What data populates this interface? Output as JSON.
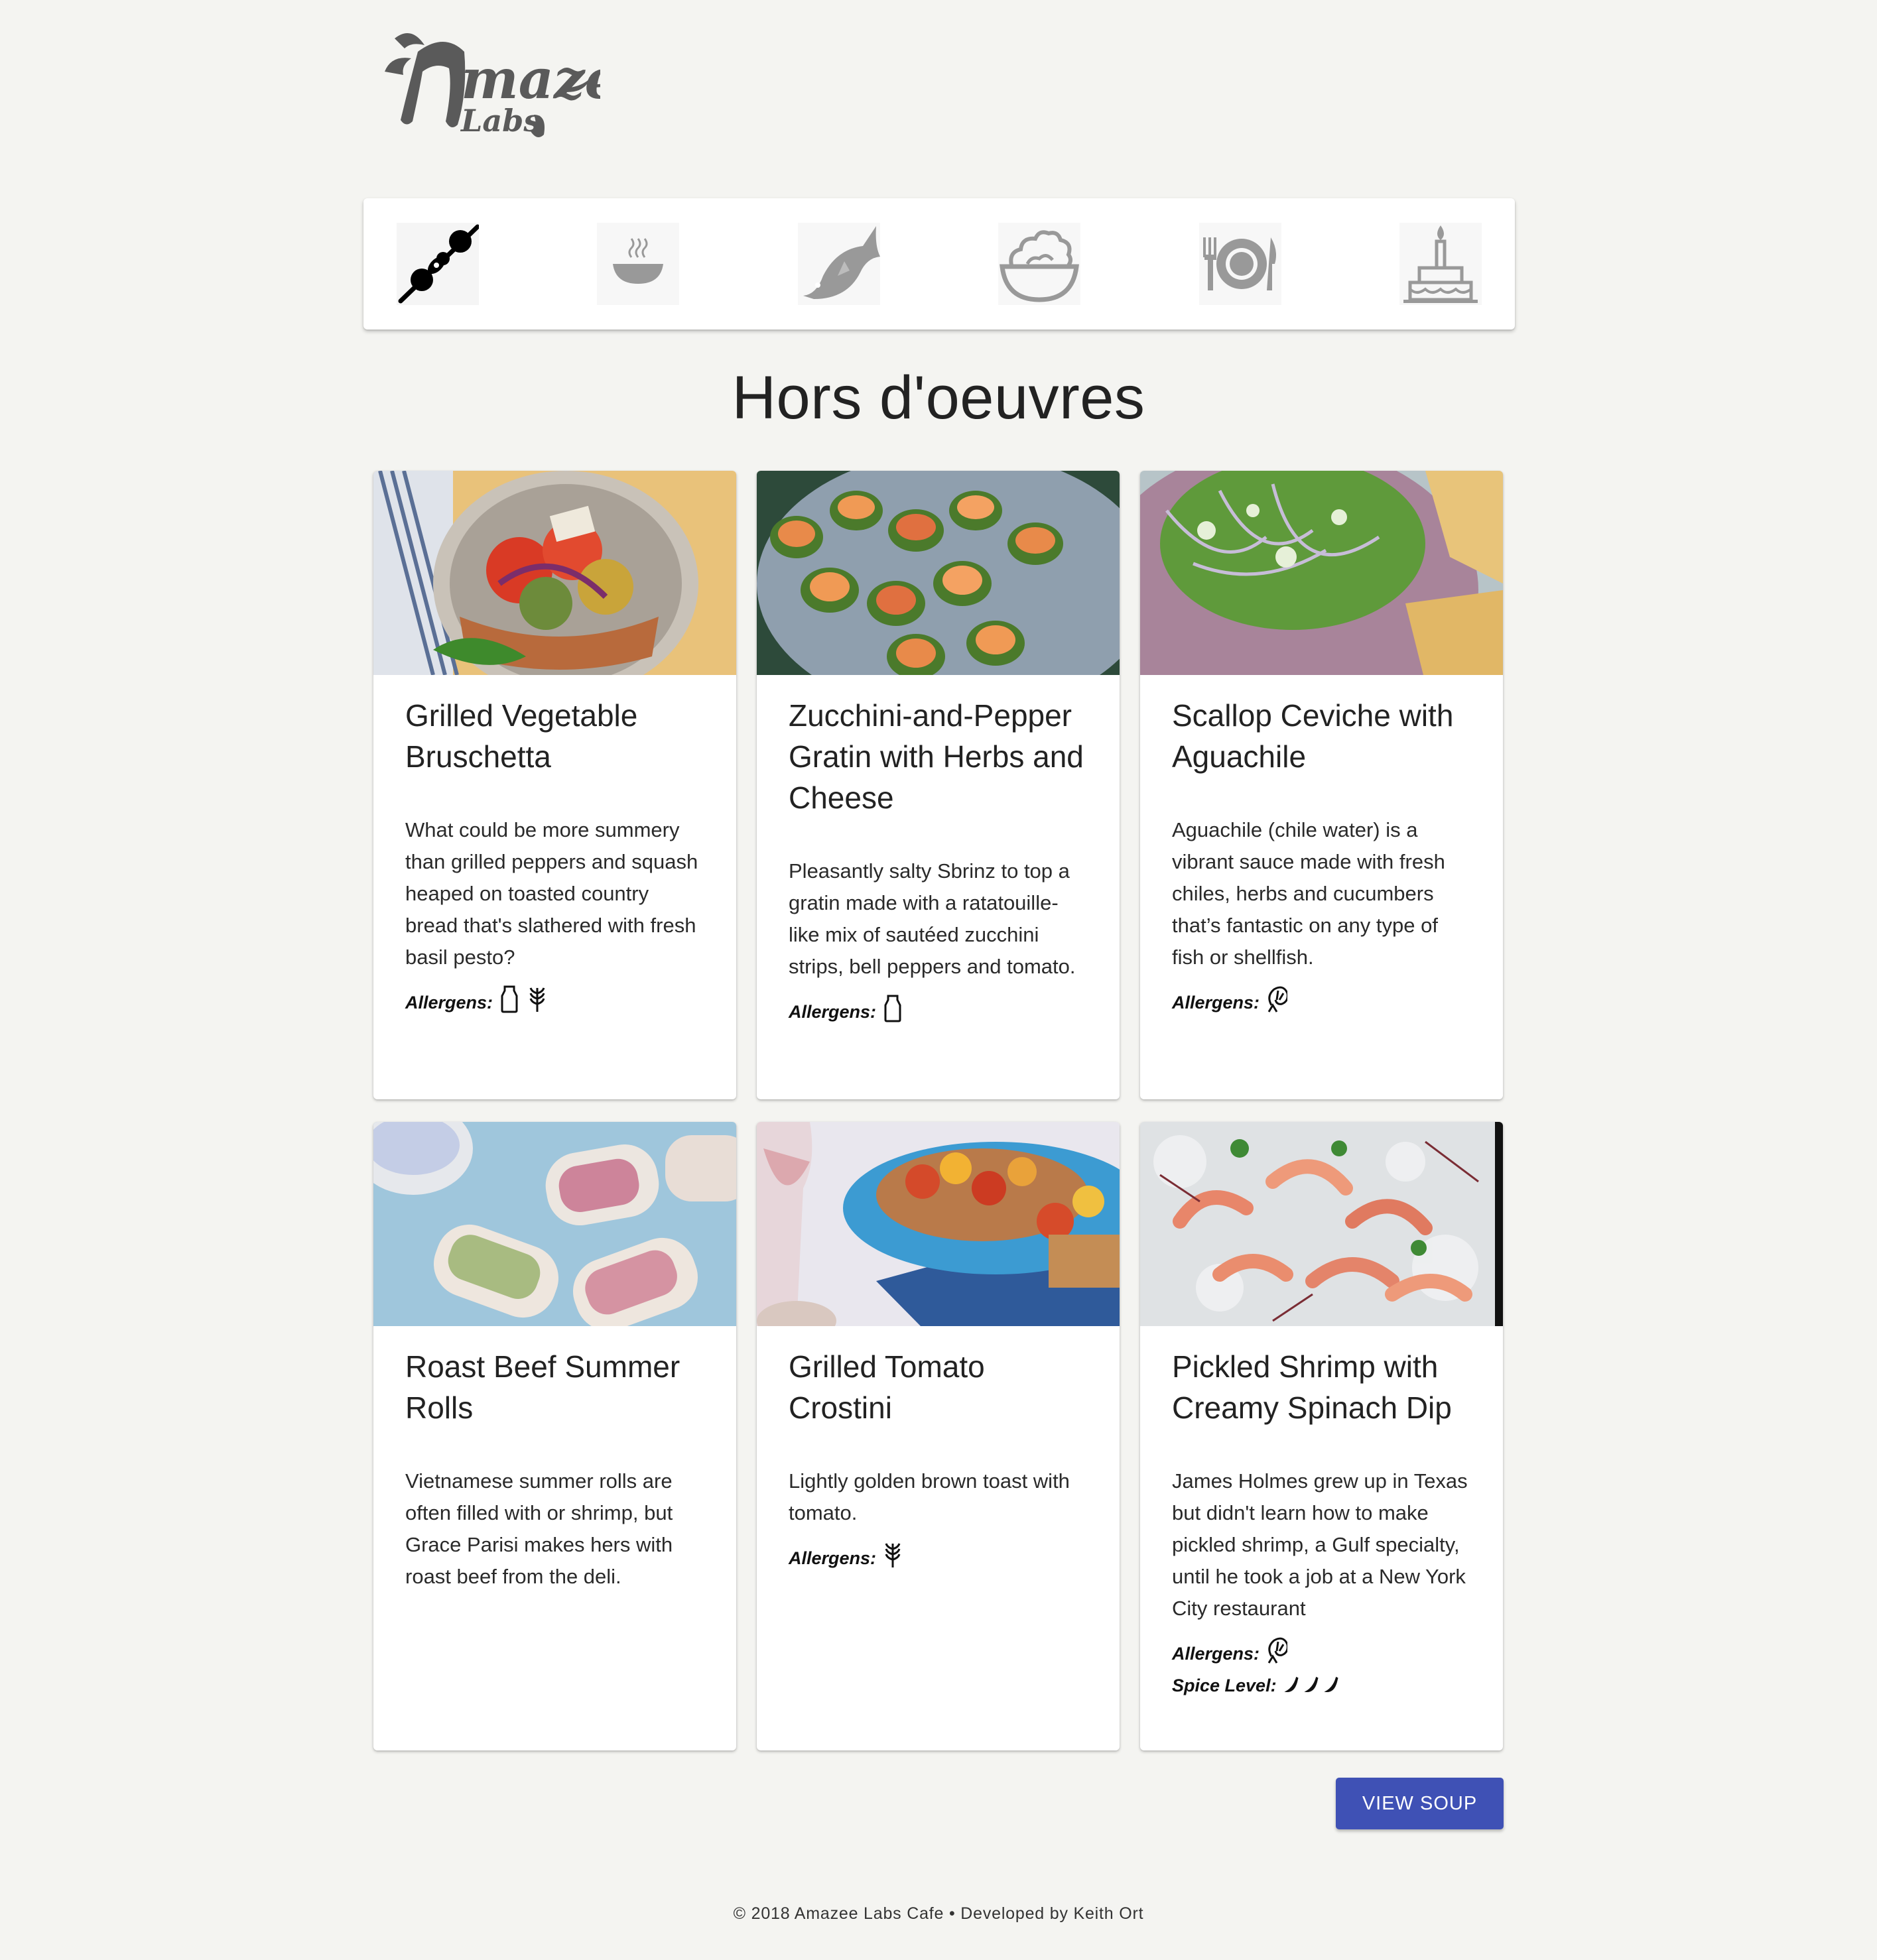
{
  "app": {
    "logo_text": "Amazee Labs"
  },
  "category_nav": {
    "items": [
      {
        "icon": "skewer-icon",
        "label": "Hors d'oeuvres",
        "active": true
      },
      {
        "icon": "soup-icon",
        "label": "Soup",
        "active": false
      },
      {
        "icon": "fish-icon",
        "label": "Fish",
        "active": false
      },
      {
        "icon": "salad-icon",
        "label": "Salad",
        "active": false
      },
      {
        "icon": "plate-icon",
        "label": "Main",
        "active": false
      },
      {
        "icon": "cake-icon",
        "label": "Dessert",
        "active": false
      }
    ]
  },
  "main": {
    "section_title": "Hors d'oeuvres",
    "allergens_label": "Allergens:",
    "spice_label": "Spice Level:",
    "cards": [
      {
        "title": "Grilled Vegetable Bruschetta",
        "description": "What could be more summery than grilled peppers and squash heaped on toasted country bread that's slathered with fresh basil pesto?",
        "allergens": [
          "milk-bottle-icon",
          "wheat-icon"
        ]
      },
      {
        "title": "Zucchini-and-Pepper Gratin with Herbs and Cheese",
        "description": "Pleasantly salty Sbrinz to top a gratin made with a ratatouille-like mix of sautéed zucchini strips, bell peppers and tomato.",
        "allergens": [
          "milk-bottle-icon"
        ]
      },
      {
        "title": "Scallop Ceviche with Aguachile",
        "description": "Aguachile (chile water) is a vibrant sauce made with fresh chiles, herbs and cucumbers that’s fantastic on any type of fish or shellfish.",
        "allergens": [
          "shrimp-icon"
        ]
      },
      {
        "title": "Roast Beef Summer Rolls",
        "description": "Vietnamese summer rolls are often filled with or shrimp, but Grace Parisi makes hers with roast beef from the deli.",
        "allergens": []
      },
      {
        "title": "Grilled Tomato Crostini",
        "description": "Lightly golden brown toast with tomato.",
        "allergens": [
          "wheat-icon"
        ]
      },
      {
        "title": "Pickled Shrimp with Creamy Spinach Dip",
        "description": "James Holmes grew up in Texas but didn't learn how to make pickled shrimp, a Gulf specialty, until he took a job at a New York City restaurant",
        "allergens": [
          "shrimp-icon"
        ],
        "spice_level": 3
      }
    ],
    "next_button": "VIEW SOUP"
  },
  "footer": {
    "text": "© 2018 Amazee Labs Cafe • Developed by Keith Ort"
  },
  "colors": {
    "background": "#f4f4f1",
    "primary_button": "#3f51b5",
    "active_icon": "#111111",
    "inactive_icon": "#999999"
  }
}
